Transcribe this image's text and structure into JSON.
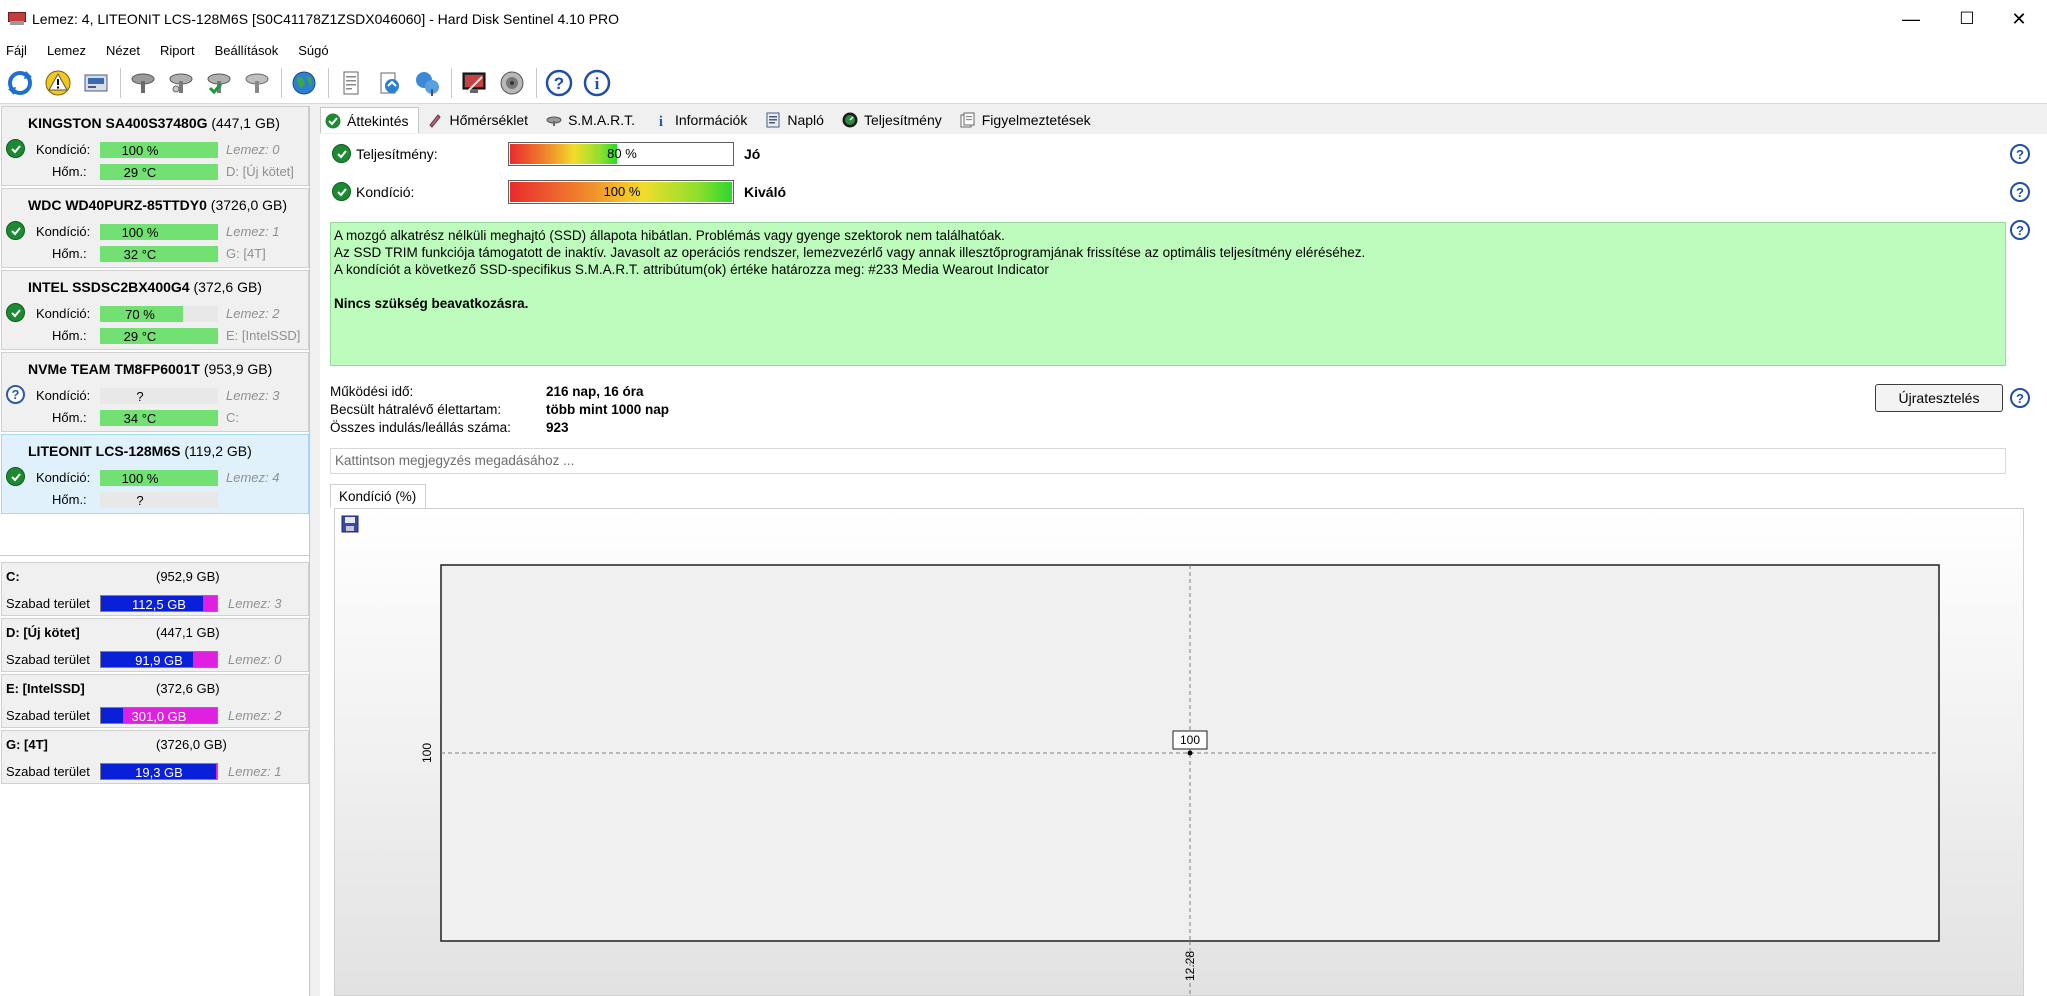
{
  "window": {
    "title": "Lemez: 4, LITEONIT LCS-128M6S [S0C41178Z1ZSDX046060]  -  Hard Disk Sentinel 4.10 PRO",
    "minimize": "—",
    "maximize": "☐",
    "close": "✕"
  },
  "menu": [
    "Fájl",
    "Lemez",
    "Nézet",
    "Riport",
    "Beállítások",
    "Súgó"
  ],
  "disks": [
    {
      "name_bold": "KINGSTON SA400S37480G",
      "size": "(447,1 GB)",
      "status": "ok",
      "health_label": "Kondíció:",
      "health": "100 %",
      "health_pct": 100,
      "health_right": "Lemez: 0",
      "temp_label": "Hőm.:",
      "temp": "29 °C",
      "temp_pct": 100,
      "temp_right": "D: [Új kötet]"
    },
    {
      "name_bold": "WDC WD40PURZ-85TTDY0",
      "size": "(3726,0 GB)",
      "status": "ok",
      "health_label": "Kondíció:",
      "health": "100 %",
      "health_pct": 100,
      "health_right": "Lemez: 1",
      "temp_label": "Hőm.:",
      "temp": "32 °C",
      "temp_pct": 100,
      "temp_right": "G: [4T]"
    },
    {
      "name_bold": "INTEL SSDSC2BX400G4",
      "size": "(372,6 GB)",
      "status": "ok",
      "health_label": "Kondíció:",
      "health": "70 %",
      "health_pct": 70,
      "health_right": "Lemez: 2",
      "temp_label": "Hőm.:",
      "temp": "29 °C",
      "temp_pct": 100,
      "temp_right": "E: [IntelSSD]"
    },
    {
      "name_bold": "NVMe    TEAM TM8FP6001T",
      "size": "(953,9 GB)",
      "status": "unknown",
      "health_label": "Kondíció:",
      "health": "?",
      "health_pct": 0,
      "health_right": "Lemez: 3",
      "temp_label": "Hőm.:",
      "temp": "34 °C",
      "temp_pct": 100,
      "temp_right": "C:"
    },
    {
      "name_bold": "LITEONIT LCS-128M6S",
      "size": "(119,2 GB)",
      "status": "ok",
      "selected": true,
      "health_label": "Kondíció:",
      "health": "100 %",
      "health_pct": 100,
      "health_right": "Lemez: 4",
      "temp_label": "Hőm.:",
      "temp": "?",
      "temp_pct": 0,
      "temp_right": ""
    }
  ],
  "volumes": [
    {
      "name": "C:",
      "size": "(952,9 GB)",
      "free_label": "Szabad terület",
      "free": "112,5 GB",
      "used_pct": 88,
      "disk": "Lemez: 3"
    },
    {
      "name": "D: [Új kötet]",
      "size": "(447,1 GB)",
      "free_label": "Szabad terület",
      "free": "91,9 GB",
      "used_pct": 79,
      "disk": "Lemez: 0"
    },
    {
      "name": "E: [IntelSSD]",
      "size": "(372,6 GB)",
      "free_label": "Szabad terület",
      "free": "301,0 GB",
      "used_pct": 19,
      "disk": "Lemez: 2"
    },
    {
      "name": "G: [4T]",
      "size": "(3726,0 GB)",
      "free_label": "Szabad terület",
      "free": "19,3 GB",
      "used_pct": 99,
      "disk": "Lemez: 1"
    }
  ],
  "tabs": [
    "Áttekintés",
    "Hőmérséklet",
    "S.M.A.R.T.",
    "Információk",
    "Napló",
    "Teljesítmény",
    "Figyelmeztetések"
  ],
  "overview": {
    "performance_label": "Teljesítmény:",
    "performance": "80 %",
    "performance_pct": 80,
    "performance_rating": "Jó",
    "health_label": "Kondíció:",
    "health": "100 %",
    "health_pct": 100,
    "health_rating": "Kiváló",
    "message_lines": [
      "A mozgó alkatrész nélküli meghajtó (SSD) állapota hibátlan. Problémás vagy gyenge szektorok nem találhatóak.",
      "Az SSD TRIM funkciója támogatott de inaktív. Javasolt az operációs rendszer, lemezvezérlő vagy annak illesztőprogramjának frissítése az optimális teljesítmény eléréséhez.",
      "A kondíciót a következő SSD-specifikus S.M.A.R.T. attribútum(ok) értéke határozza meg:  #233 Media Wearout Indicator"
    ],
    "message_bold": "Nincs szükség beavatkozásra.",
    "uptime_label": "Működési idő:",
    "uptime": "216 nap, 16 óra",
    "lifetime_label": "Becsült hátralévő élettartam:",
    "lifetime": "több mint 1000 nap",
    "starts_label": "Összes indulás/leállás száma:",
    "starts": "923",
    "retest_label": "Újratesztelés",
    "note_placeholder": "Kattintson megjegyzés megadásához ..."
  },
  "chart_tab": "Kondíció  (%)",
  "chart_data": {
    "type": "line",
    "title": "",
    "x": [
      "12.28"
    ],
    "values": [
      100
    ],
    "data_labels": [
      "100"
    ],
    "y_tick_labels": [
      "100"
    ],
    "x_tick_labels": [
      "12.28"
    ],
    "grid": true
  },
  "colors": {
    "ok_green": "#1d8a33",
    "bar_green": "#73e073",
    "message_bg": "#bdfcbd",
    "volume_used": "#0a1fd8",
    "volume_free": "#e020e0",
    "help_blue": "#1f4fa6"
  }
}
